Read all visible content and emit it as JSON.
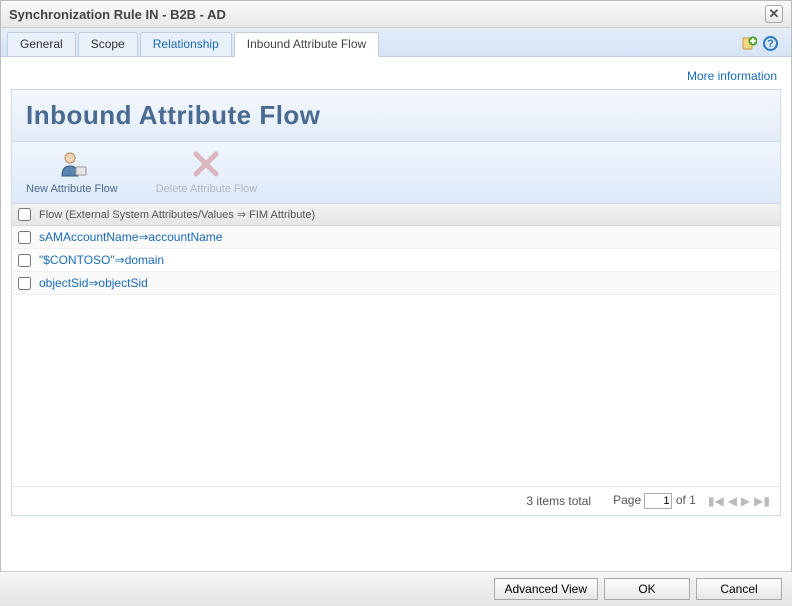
{
  "window": {
    "title": "Synchronization Rule IN - B2B - AD"
  },
  "tabs": {
    "items": [
      {
        "label": "General"
      },
      {
        "label": "Scope"
      },
      {
        "label": "Relationship"
      },
      {
        "label": "Inbound Attribute Flow"
      }
    ],
    "active_index": 3,
    "link_indices": [
      2
    ]
  },
  "links": {
    "more_information": "More information"
  },
  "panel": {
    "heading": "Inbound Attribute Flow"
  },
  "toolbar": {
    "new_flow": "New Attribute Flow",
    "delete_flow": "Delete Attribute Flow"
  },
  "list": {
    "column_header": "Flow (External System Attributes/Values ⇒ FIM Attribute)",
    "rows": [
      {
        "text": "sAMAccountName⇒accountName"
      },
      {
        "text": "\"$CONTOSO\"⇒domain"
      },
      {
        "text": "objectSid⇒objectSid"
      }
    ]
  },
  "pager": {
    "total_text": "3 items total",
    "page_label_prefix": "Page",
    "page_value": "1",
    "page_label_suffix": "of 1"
  },
  "footer": {
    "advanced_view": "Advanced View",
    "ok": "OK",
    "cancel": "Cancel"
  }
}
